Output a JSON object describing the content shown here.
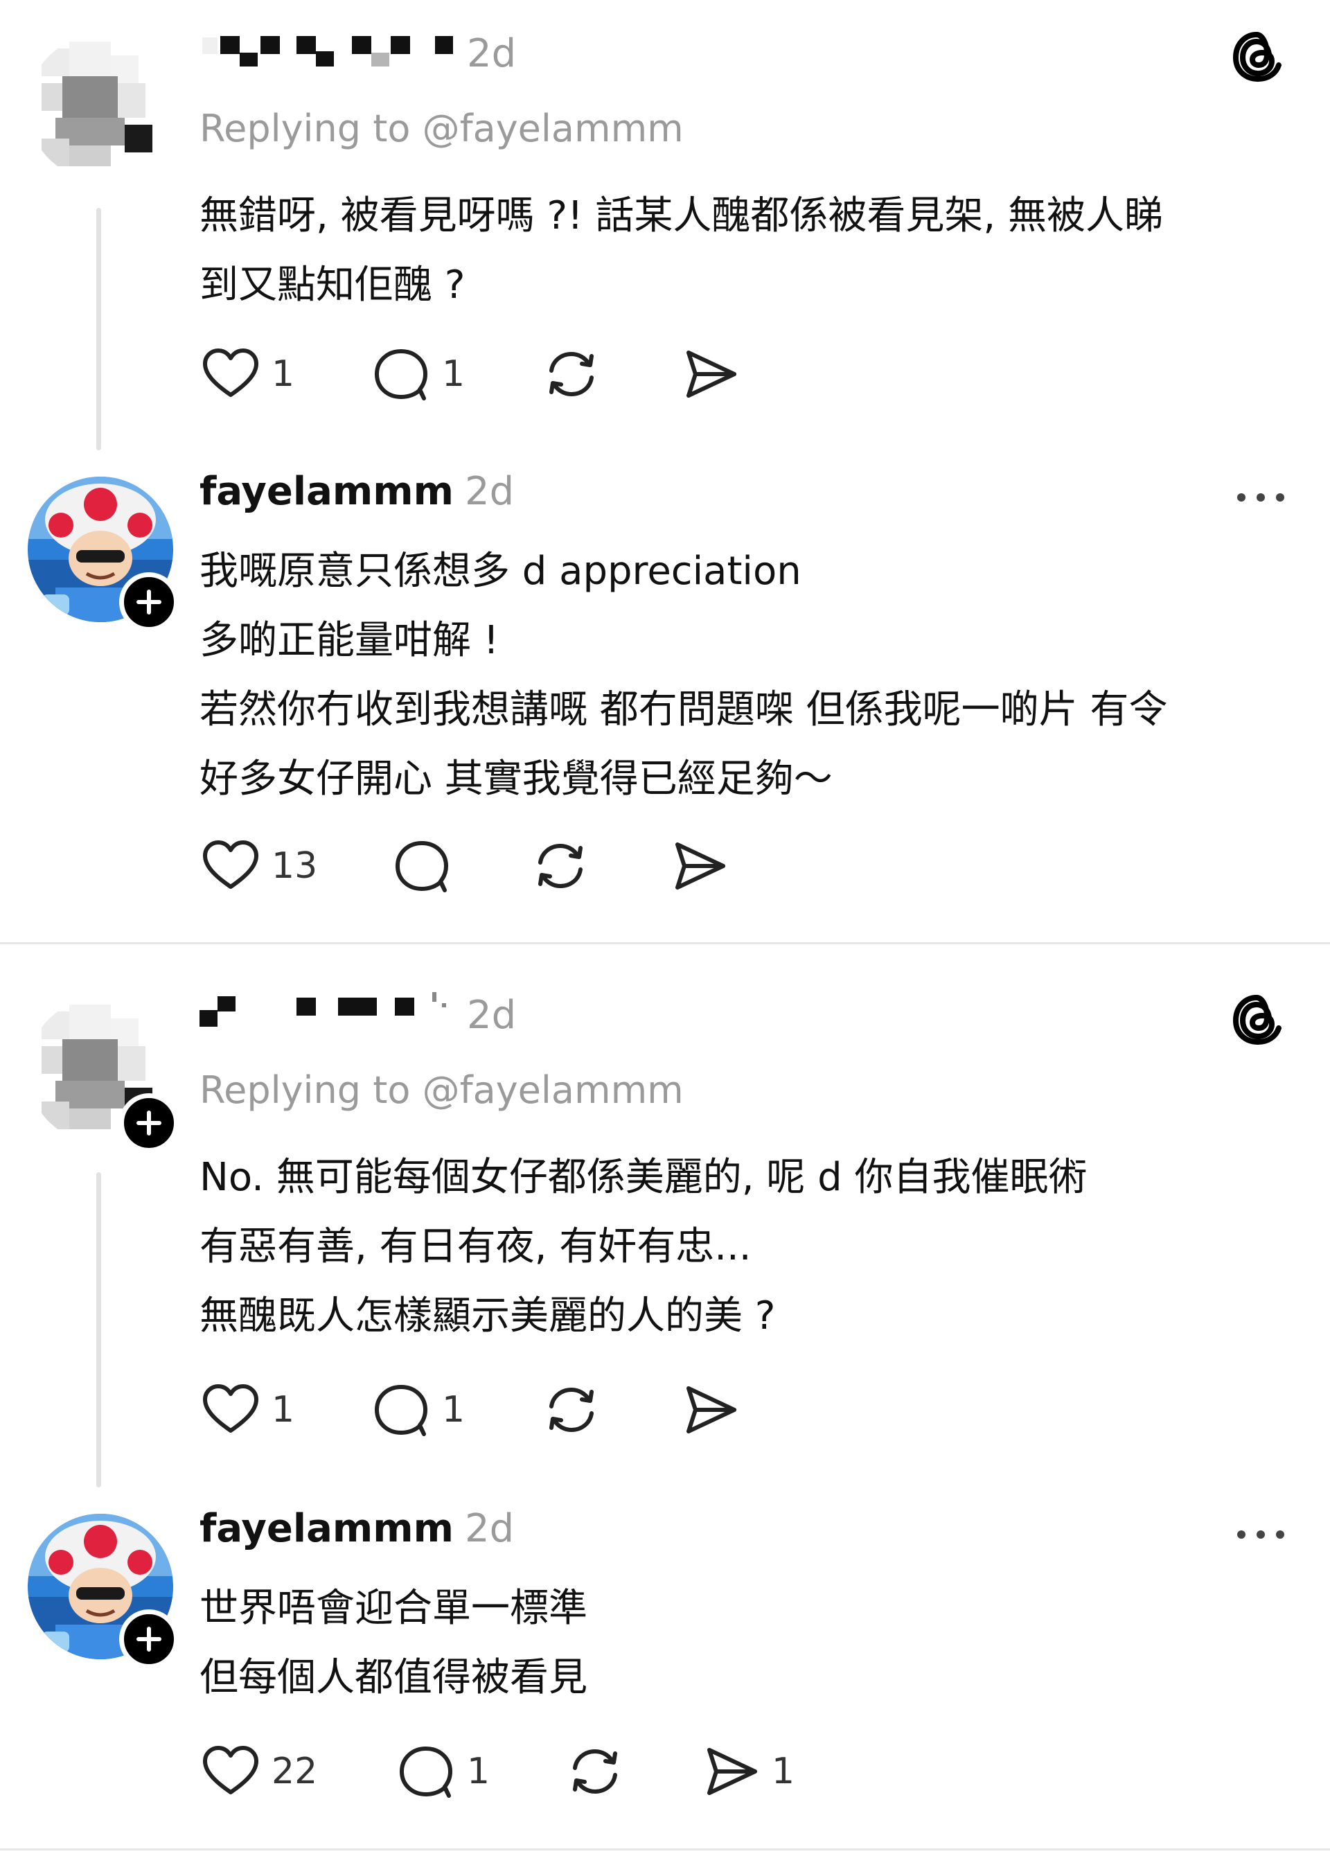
{
  "posts": [
    {
      "author_masked": true,
      "timestamp": "2d",
      "replying_to": "Replying to @fayelammm",
      "lines": [
        "無錯呀, 被看見呀嗎 ?! 話某人醜都係被看見架, 無被人睇",
        "到又點知佢醜 ?"
      ],
      "likes": "1",
      "replies": "1",
      "shares": ""
    },
    {
      "author": "fayelammm",
      "timestamp": "2d",
      "lines": [
        "我嘅原意只係想多 d appreciation",
        "多啲正能量咁解 !",
        "若然你冇收到我想講嘅 都冇問題㗎 但係我呢一啲片 有令",
        "好多女仔開心 其實我覺得已經足夠～"
      ],
      "likes": "13",
      "replies": "",
      "shares": ""
    },
    {
      "author_masked": true,
      "timestamp": "2d",
      "replying_to": "Replying to @fayelammm",
      "lines": [
        "No. 無可能每個女仔都係美麗的, 呢 d 你自我催眠術",
        "有惡有善, 有日有夜, 有奸有忠...",
        "無醜既人怎樣顯示美麗的人的美 ?"
      ],
      "likes": "1",
      "replies": "1",
      "shares": ""
    },
    {
      "author": "fayelammm",
      "timestamp": "2d",
      "lines": [
        "世界唔會迎合單一標準",
        "但每個人都值得被看見"
      ],
      "likes": "22",
      "replies": "1",
      "shares": "1"
    }
  ],
  "icons": {
    "like": "heart-icon",
    "reply": "comment-bubble-icon",
    "repost": "repost-icon",
    "share": "send-icon",
    "brand": "threads-logo-icon",
    "more": "more-dots-icon",
    "follow": "plus-icon"
  },
  "colors": {
    "text": "#111111",
    "muted": "#9a9a9a",
    "divider": "#e6e6e6",
    "thread_line": "#e2e2e2"
  }
}
